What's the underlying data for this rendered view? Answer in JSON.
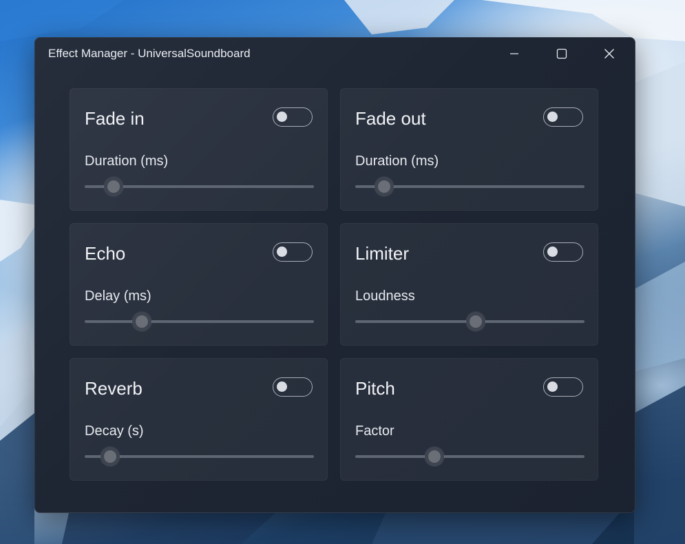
{
  "window": {
    "title": "Effect Manager - UniversalSoundboard"
  },
  "captions": {
    "minimize_icon": "minimize-icon",
    "maximize_icon": "maximize-icon",
    "close_icon": "close-icon"
  },
  "effects": [
    {
      "title": "Fade in",
      "enabled": false,
      "param_label": "Duration (ms)",
      "slider_fraction": 0.125
    },
    {
      "title": "Fade out",
      "enabled": false,
      "param_label": "Duration (ms)",
      "slider_fraction": 0.125
    },
    {
      "title": "Echo",
      "enabled": false,
      "param_label": "Delay (ms)",
      "slider_fraction": 0.25
    },
    {
      "title": "Limiter",
      "enabled": false,
      "param_label": "Loudness",
      "slider_fraction": 0.525
    },
    {
      "title": "Reverb",
      "enabled": false,
      "param_label": "Decay (s)",
      "slider_fraction": 0.11
    },
    {
      "title": "Pitch",
      "enabled": false,
      "param_label": "Factor",
      "slider_fraction": 0.345
    }
  ],
  "colors": {
    "window_bg": "#1e2533",
    "card_bg": "#272e3b",
    "toggle_border": "#a9afb9",
    "track": "#5e6674"
  }
}
